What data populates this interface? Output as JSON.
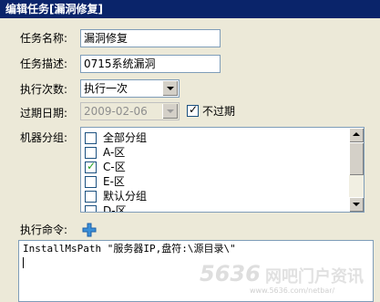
{
  "window": {
    "title": "编辑任务[漏洞修复]"
  },
  "form": {
    "task_name": {
      "label": "任务名称:",
      "value": "漏洞修复"
    },
    "task_desc": {
      "label": "任务描述:",
      "value": "0715系统漏洞"
    },
    "exec_count": {
      "label": "执行次数:",
      "value": "执行一次"
    },
    "expire_date": {
      "label": "过期日期:",
      "value": "2009-02-06",
      "never_expire_label": "不过期",
      "never_expire_checked": true
    },
    "machine_group": {
      "label": "机器分组:",
      "items": [
        {
          "label": "全部分组",
          "checked": false
        },
        {
          "label": "A-区",
          "checked": false
        },
        {
          "label": "C-区",
          "checked": true
        },
        {
          "label": "E-区",
          "checked": false
        },
        {
          "label": "默认分组",
          "checked": false
        },
        {
          "label": "D-区",
          "checked": false
        }
      ]
    },
    "command": {
      "label": "执行命令:",
      "add_icon": "plus-icon",
      "value": "InstallMsPath \"服务器IP,盘符:\\源目录\\\""
    }
  },
  "watermark": {
    "logo": "5636",
    "sub": "网吧门户资讯",
    "url": "www.5636.com/netbar/"
  }
}
